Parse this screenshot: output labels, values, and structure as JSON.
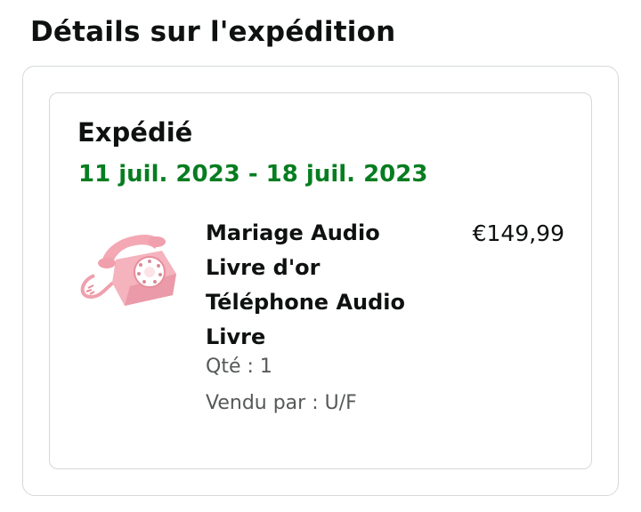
{
  "page": {
    "title": "Détails sur l'expédition"
  },
  "shipment": {
    "status": "Expédié",
    "dates": "11 juil. 2023 - 18 juil. 2023",
    "status_color": "#067d20"
  },
  "item": {
    "title": "Mariage Audio Livre d'or Téléphone Audio Livre",
    "price": "€149,99",
    "quantity": "Qté : 1",
    "seller": "Vendu par : U/F",
    "image_icon": "pink-rotary-telephone-icon",
    "image_color": "#f2a9b4"
  }
}
